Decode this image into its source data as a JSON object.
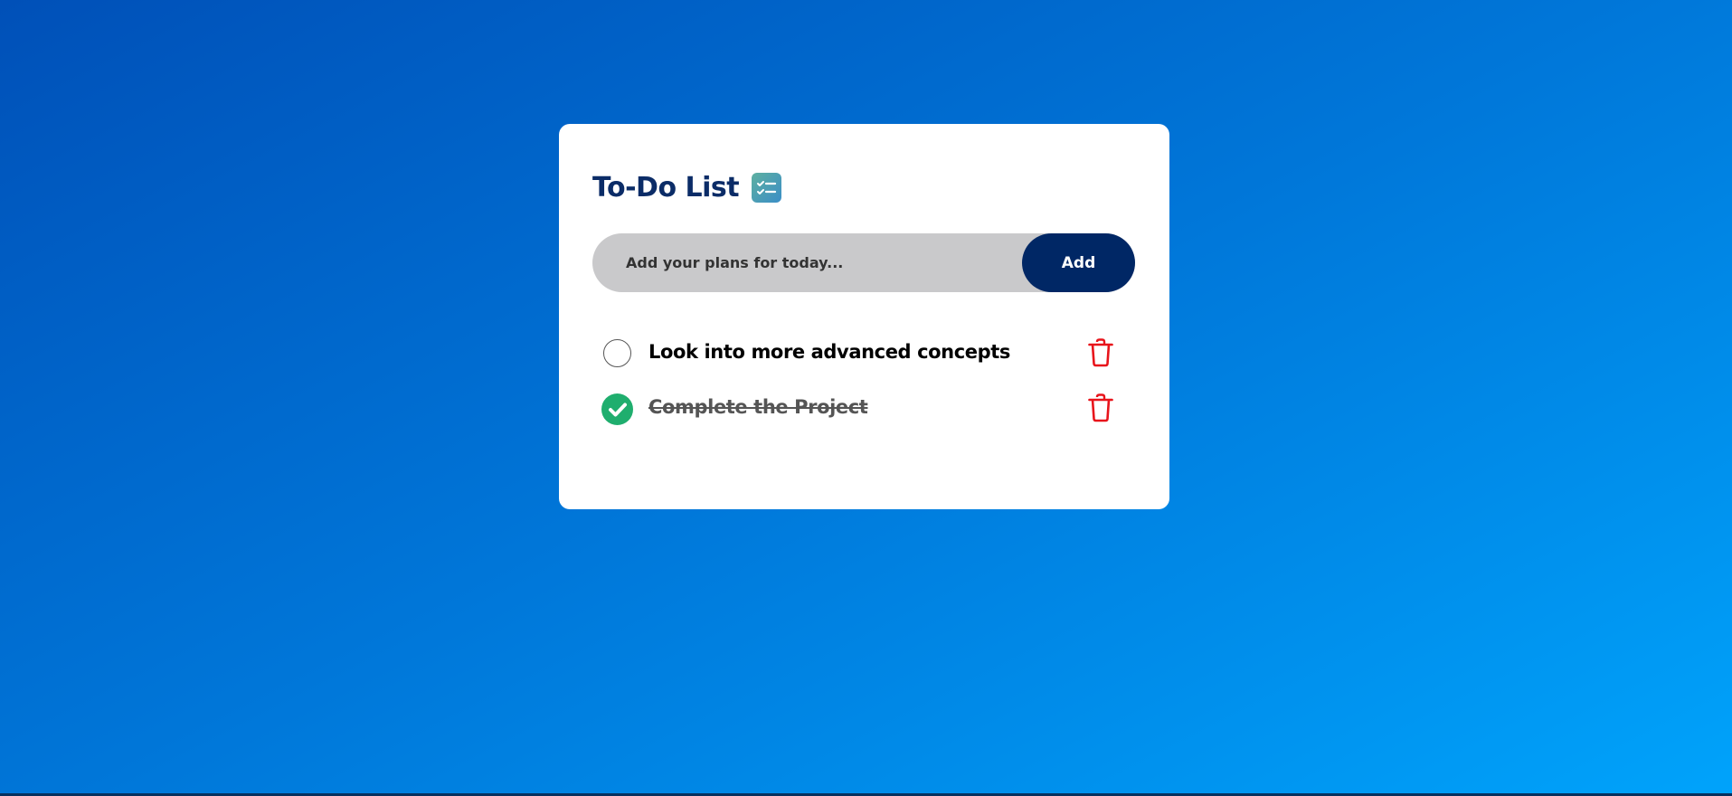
{
  "app": {
    "title": "To-Do List",
    "title_icon": "checklist-icon",
    "accent": "#002765",
    "title_color": "#0b2c67"
  },
  "input": {
    "placeholder": "Add your plans for today...",
    "value": ""
  },
  "add_button": {
    "label": "Add"
  },
  "tasks": [
    {
      "text": "Look into more advanced concepts",
      "completed": false,
      "check_icon": "empty-circle-icon",
      "delete_icon": "trash-icon"
    },
    {
      "text": "Complete the Project",
      "completed": true,
      "check_icon": "check-circle-icon",
      "delete_icon": "trash-icon"
    }
  ],
  "colors": {
    "background_start": "#0050b8",
    "background_end": "#00a3fb",
    "check_green": "#1fae6e",
    "delete_red": "#e8141b"
  }
}
